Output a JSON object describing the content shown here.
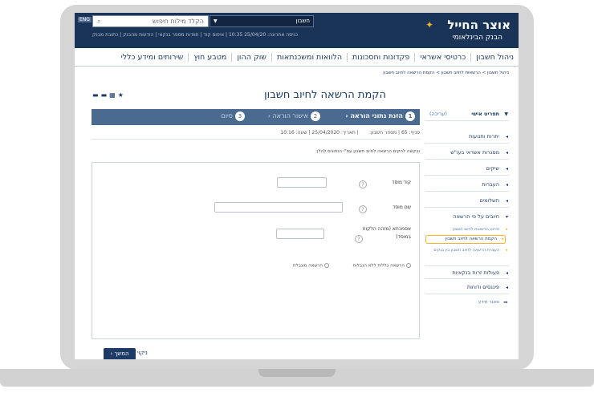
{
  "topbar": {
    "logo_title": "אוצר החייל",
    "logo_subtitle": "הבנק הבינלאומי",
    "logo_icon": "bank-logo-icon",
    "search_placeholder": "הקלד מילות חיפוש",
    "english_label": "ENG",
    "account_label": "חשבון",
    "top_info": "כניסה אחרונה: 25/04/20 10:35 | איפוס קוד | חוודות מספר בנקאי | הודעות מהבנק | כתובת מבנק"
  },
  "nav": {
    "items": [
      {
        "label": "ניהול חשבון"
      },
      {
        "label": "כרטיסי אשראי"
      },
      {
        "label": "פקדונות וחסכונות"
      },
      {
        "label": "הלוואות ומשכנתאות"
      },
      {
        "label": "שוק ההון"
      },
      {
        "label": "מטבע חוץ"
      },
      {
        "label": "שירותים ומידע כללי"
      }
    ]
  },
  "breadcrumb": "ניהול חשבון > הרשאות לחיוב חשבון > הקמת הרשאה לחיוב חשבון",
  "page_title": "הקמת הרשאה לחיוב חשבון",
  "sidebar": {
    "header": "תפריט אישי",
    "header_tag": "(עריכה)",
    "items": [
      {
        "label": "יתרות ותנועות"
      },
      {
        "label": "מסגרות אשראי בעו\"ש"
      },
      {
        "label": "שיקים"
      },
      {
        "label": "העברות"
      },
      {
        "label": "תשלומים"
      },
      {
        "label": "חיובים על פי הרשאה"
      }
    ],
    "sub_items": [
      {
        "label": "פירוט הרשאות לחיוב חשבון"
      },
      {
        "label": "הקמת הרשאה לחיוב חשבון"
      },
      {
        "label": "העברת הרשאה לחיוב חשבון בין בנקים"
      }
    ],
    "bottom_items": [
      {
        "label": "פעולות זרות בנקאיות"
      },
      {
        "label": "פיננסים ודוחות"
      }
    ],
    "footer_link": "מאגר מידע"
  },
  "steps": [
    {
      "num": "1",
      "label": "הזנת נתוני הוראה"
    },
    {
      "num": "2",
      "label": "אישור הוראה"
    },
    {
      "num": "3",
      "label": "סיום"
    }
  ],
  "info": {
    "branch_label": "סניף:",
    "branch_value": "65",
    "account_label": "מספר חשבון:",
    "date_label": "תאריך:",
    "date_value": "25/04/2020",
    "time_label": "שעה:",
    "time_value": "10:16"
  },
  "note": "ובקשה להקים הרשאה לחיוב חשבון עפ\"י הנתונים להלן:",
  "form": {
    "field1_label": "קוד מוסד",
    "field2_label": "שם מוסד",
    "field3_label": "אסמכתא (מזהה הלקוח במוסד)",
    "radio1": "הרשאה כללית ללא הגבלות",
    "radio2": "הרשאה מוגבלת"
  },
  "buttons": {
    "next": "המשך",
    "clear": "ניקוי"
  }
}
